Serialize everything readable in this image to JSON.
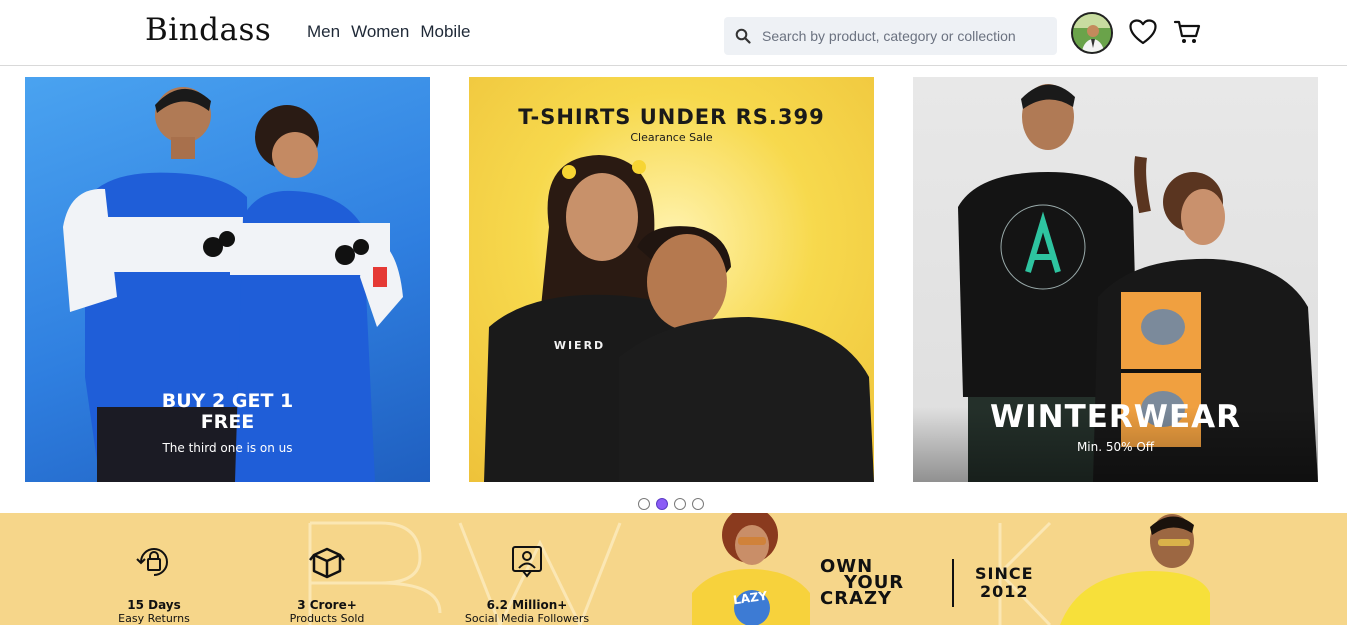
{
  "header": {
    "logo": "Bindass",
    "nav": [
      "Men",
      "Women",
      "Mobile"
    ],
    "search_placeholder": "Search by product, category or collection",
    "icons": [
      "search-icon",
      "avatar",
      "heart-icon",
      "cart-icon"
    ]
  },
  "carousel": {
    "slides": [
      {
        "title_line1": "BUY 2 GET 1",
        "title_line2": "FREE",
        "subtitle": "The third one is on us"
      },
      {
        "title": "T-SHIRTS UNDER RS.399",
        "subtitle": "Clearance Sale",
        "shirt_text": "WIERD"
      },
      {
        "title": "WINTERWEAR",
        "subtitle": "Min. 50% Off"
      }
    ],
    "dots": 4,
    "active_dot": 1
  },
  "banner": {
    "features": [
      {
        "icon": "returns-bag-icon",
        "title": "15 Days",
        "subtitle": "Easy Returns"
      },
      {
        "icon": "box-icon",
        "title": "3 Crore+",
        "subtitle": "Products Sold"
      },
      {
        "icon": "profile-frame-icon",
        "title": "6.2 Million+",
        "subtitle": "Social Media Followers"
      }
    ],
    "tagline": [
      "OWN",
      "YOUR",
      "CRAZY"
    ],
    "since": [
      "SINCE",
      "2012"
    ],
    "shirt_text": "LAZY"
  },
  "colors": {
    "banner_bg": "#f6d68a",
    "active_dot": "#8b5cf6",
    "slide1_bg": "#2f7fe0",
    "slide2_bg": "#f7d94d"
  }
}
